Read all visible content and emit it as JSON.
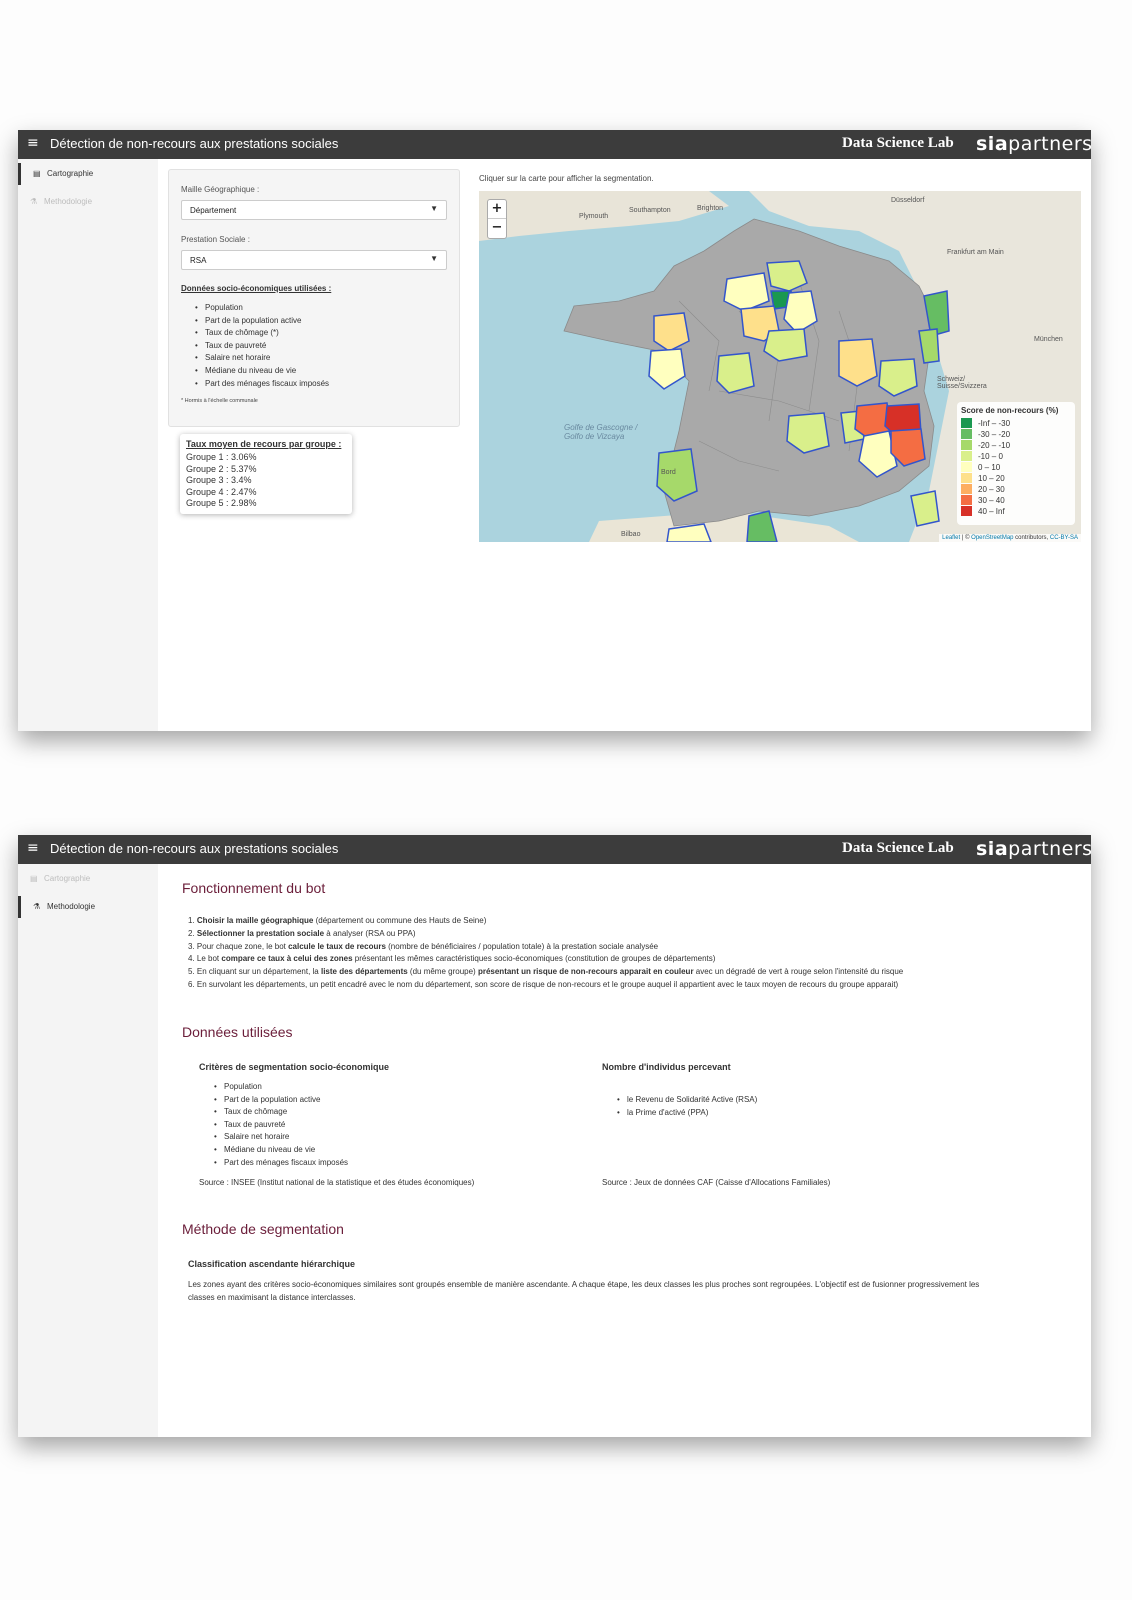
{
  "app": {
    "title": "Détection de non-recours aux prestations sociales",
    "brand_lab": "Data Science Lab",
    "brand_sia_bold": "sia",
    "brand_sia_light": "partners"
  },
  "sidebar": {
    "items": [
      {
        "label": "Cartographie",
        "icon": "map-icon"
      },
      {
        "label": "Methodologie",
        "icon": "flask-icon"
      }
    ]
  },
  "cartographie": {
    "maille_label": "Maille Géographique :",
    "maille_value": "Département",
    "prestation_label": "Prestation Sociale :",
    "prestation_value": "RSA",
    "donnees_title": "Données socio-économiques utilisées :",
    "donnees_items": [
      "Population",
      "Part de la population active",
      "Taux de chômage (*)",
      "Taux de pauvreté",
      "Salaire net horaire",
      "Médiane du niveau de vie",
      "Part des ménages fiscaux imposés"
    ],
    "footnote": "* Hormis à l'échelle communale",
    "recours_title": "Taux moyen de recours par groupe :",
    "recours_groups": [
      "Groupe 1 : 3.06%",
      "Groupe 2 : 5.37%",
      "Groupe 3 : 3.4%",
      "Groupe 4 : 2.47%",
      "Groupe 5 : 2.98%"
    ],
    "map_hint": "Cliquer sur la carte pour afficher la segmentation.",
    "zoom_in": "+",
    "zoom_out": "−",
    "legend_title": "Score de non-recours (%)",
    "legend_rows": [
      {
        "label": "-Inf – -30",
        "color": "#1a9850"
      },
      {
        "label": "-30 – -20",
        "color": "#66bd63"
      },
      {
        "label": "-20 – -10",
        "color": "#a6d96a"
      },
      {
        "label": "-10 – 0",
        "color": "#d9ef8b"
      },
      {
        "label": "0 – 10",
        "color": "#ffffbf"
      },
      {
        "label": "10 – 20",
        "color": "#fee08b"
      },
      {
        "label": "20 – 30",
        "color": "#fdae61"
      },
      {
        "label": "30 – 40",
        "color": "#f46d43"
      },
      {
        "label": "40 – Inf",
        "color": "#d73027"
      }
    ],
    "attribution": {
      "leaflet": "Leaflet",
      "sep": " | © ",
      "osm": "OpenStreetMap",
      "contrib": " contributors, ",
      "license": "CC-BY-SA"
    },
    "map_labels": {
      "sea": "Golfe de Gascogne / Golfo de Vizcaya",
      "plymouth": "Plymouth",
      "southampton": "Southampton",
      "brighton": "Brighton",
      "dusseldorf": "Düsseldorf",
      "frankfurt": "Frankfurt am Main",
      "munchen": "München",
      "bordeaux": "Bord",
      "bilbao": "Bilbao",
      "suisse": "Schweiz/ Suisse/Svizzera"
    }
  },
  "methodologie": {
    "h_fonctionnement": "Fonctionnement du bot",
    "steps": [
      {
        "n": "1.",
        "b": "Choisir la maille géographique",
        "t": " (département ou commune des Hauts de Seine)"
      },
      {
        "n": "2.",
        "b": "Sélectionner la prestation sociale",
        "t": " à analyser (RSA ou PPA)"
      },
      {
        "n": "3.",
        "pre": "Pour chaque zone, le bot ",
        "b": "calcule le taux de recours",
        "t": " (nombre de bénéficiaires / population totale) à la prestation sociale analysée"
      },
      {
        "n": "4.",
        "pre": "Le bot ",
        "b": "compare ce taux à celui des zones",
        "t": " présentant les mêmes caractéristiques socio-économiques (constitution de groupes de départements)"
      },
      {
        "n": "5.",
        "pre": "En cliquant sur un département, la ",
        "b": "liste des départements",
        "mid": " (du même groupe) ",
        "b2": "présentant un risque de non-recours apparait en couleur",
        "t": " avec un dégradé de vert à rouge selon l'intensité du risque"
      },
      {
        "n": "6.",
        "pre": "En survolant les départements, un petit encadré avec le nom du département, son score de risque de non-recours et le groupe auquel il appartient avec le taux moyen de recours du groupe apparait)"
      }
    ],
    "h_donnees": "Données utilisées",
    "criteres_title": "Critères de segmentation socio-économique",
    "criteres_items": [
      "Population",
      "Part de la population active",
      "Taux de chômage",
      "Taux de pauvreté",
      "Salaire net horaire",
      "Médiane du niveau de vie",
      "Part des ménages fiscaux imposés"
    ],
    "criteres_source": "Source : INSEE (Institut national de la statistique et des études économiques)",
    "individus_title": "Nombre d'individus percevant",
    "individus_items": [
      "le Revenu de Solidarité Active (RSA)",
      "la Prime d'activé (PPA)"
    ],
    "individus_source": "Source : Jeux de données CAF (Caisse d'Allocations Familiales)",
    "h_methode": "Méthode de segmentation",
    "classif_title": "Classification ascendante hiérarchique",
    "classif_text": "Les zones ayant des critères socio-économiques similaires sont groupés ensemble de manière ascendante. A chaque étape, les deux classes les plus proches sont regroupées. L'objectif est de fusionner progressivement les classes en maximisant la distance interclasses."
  }
}
